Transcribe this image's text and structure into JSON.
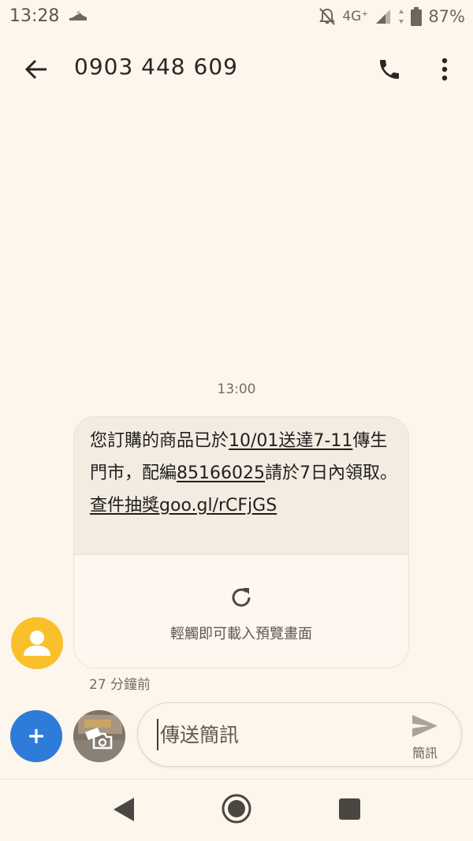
{
  "status_bar": {
    "time": "13:28",
    "network": "4G⁺",
    "battery": "87%"
  },
  "app_bar": {
    "title": "0903 448 609"
  },
  "conversation": {
    "timestamp": "13:00",
    "message": {
      "segments": [
        {
          "text": "您訂購的商品已於",
          "link": false
        },
        {
          "text": "10/01送達7-11",
          "link": true
        },
        {
          "text": "傳生門市，配編",
          "link": false
        },
        {
          "text": "85166025",
          "link": true
        },
        {
          "text": "請於7日內領取。",
          "link": false
        },
        {
          "text": "查件抽獎",
          "link": true
        },
        {
          "text": "goo.gl/rCFjGS",
          "link": true
        }
      ],
      "preview_label": "輕觸即可載入預覽畫面",
      "age": "27 分鐘前"
    }
  },
  "compose": {
    "placeholder": "傳送簡訊",
    "send_label": "簡訊"
  },
  "colors": {
    "background": "#fdf6ec",
    "bubble": "#f4ebe1",
    "accent_blue": "#2e7bd9",
    "avatar_yellow": "#f9c02b"
  }
}
